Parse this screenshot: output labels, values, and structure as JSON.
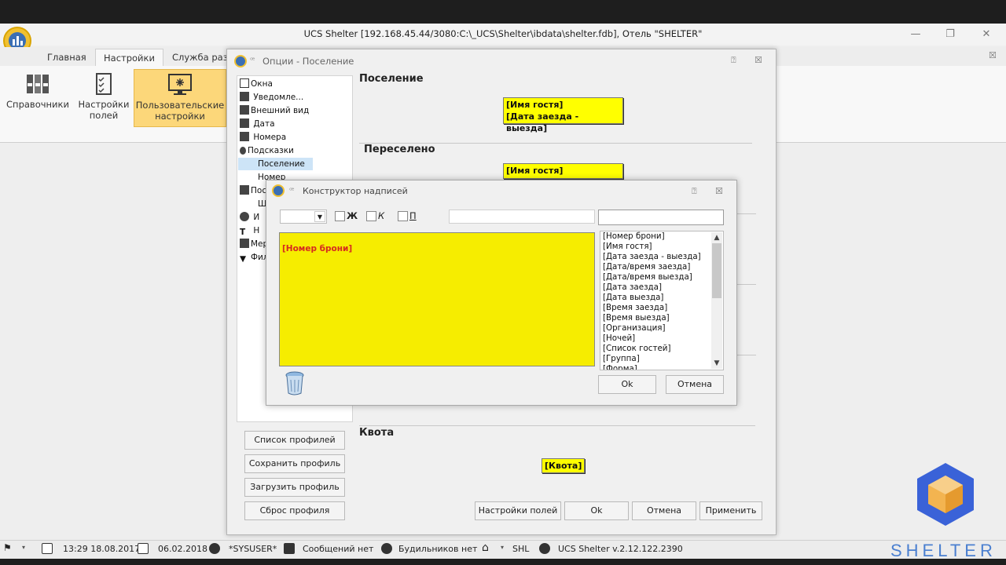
{
  "window": {
    "title": "UCS Shelter [192.168.45.44/3080:C:\\_UCS\\Shelter\\ibdata\\shelter.fdb], Отель \"SHELTER\"",
    "minimize": "—",
    "restore": "❐",
    "close": "✕"
  },
  "ribbon": {
    "tabs": [
      "Главная",
      "Настройки",
      "Служба разм"
    ],
    "buttons": [
      {
        "label1": "Справочники",
        "label2": ""
      },
      {
        "label1": "Настройки",
        "label2": "полей"
      },
      {
        "label1": "Пользовательские",
        "label2": "настройки"
      }
    ]
  },
  "options": {
    "title": "Опции - Поселение",
    "tree": [
      "Окна",
      "Уведомле...",
      "Внешний вид",
      "Дата",
      "Номера",
      "Подсказки",
      "Поселение",
      "Номер",
      "Пос",
      "Ш",
      "И",
      "Н",
      "Мер",
      "Фил"
    ],
    "sections": {
      "checkin": {
        "title": "Поселение",
        "labels": [
          "[Имя гостя]",
          "[Дата заезда - выезда]"
        ]
      },
      "moved": {
        "title": "Переселено",
        "labels": [
          "[Имя гостя]"
        ]
      },
      "quota": {
        "title": "Квота",
        "label": "[Квота]"
      }
    },
    "side_buttons": [
      "Список профилей",
      "Сохранить профиль",
      "Загрузить профиль",
      "Сброс профиля"
    ],
    "bottom_buttons": [
      "Настройки полей",
      "Ok",
      "Отмена",
      "Применить"
    ]
  },
  "constructor": {
    "title": "Конструктор надписей",
    "bold_label": "Ж",
    "italic_label": "К",
    "underline_label": "П",
    "preview_text": "[Номер брони]",
    "fields": [
      "[Номер брони]",
      "[Имя гостя]",
      "[Дата заезда - выезда]",
      "[Дата/время заезда]",
      "[Дата/время выезда]",
      "[Дата заезда]",
      "[Дата выезда]",
      "[Время заезда]",
      "[Время выезда]",
      "[Организация]",
      "[Ночей]",
      "[Список гостей]",
      "[Группа]",
      "[Форма]"
    ],
    "ok": "Ok",
    "cancel": "Отмена"
  },
  "status": {
    "datetime": "13:29 18.08.2017",
    "date": "06.02.2018",
    "user": "*SYSUSER*",
    "messages": "Сообщений нет",
    "alarms": "Будильников нет",
    "hotel": "SHL",
    "version": "UCS Shelter v.2.12.122.2390"
  },
  "brand": "SHELTER"
}
